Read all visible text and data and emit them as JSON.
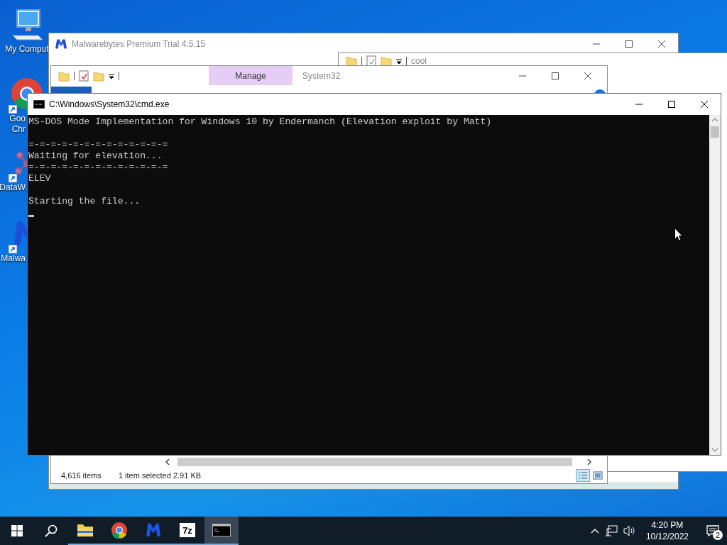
{
  "desktop_icons": [
    {
      "kind": "computer",
      "label_lines": [
        "My Comput"
      ],
      "shortcut": false
    },
    {
      "kind": "chrome",
      "label_lines": [
        "Goo",
        "Chr"
      ],
      "shortcut": true
    },
    {
      "kind": "data",
      "label_lines": [
        "DataW"
      ],
      "shortcut": true
    },
    {
      "kind": "malwarebytes",
      "label_lines": [
        "Malwa"
      ],
      "shortcut": true
    }
  ],
  "malwarebytes_window": {
    "title": "Malwarebytes Premium Trial  4.5.15"
  },
  "cool_window": {
    "title": "cool"
  },
  "system32_window": {
    "title": "System32",
    "context_tab": "Manage",
    "status_items": "4,616 items",
    "status_selected": "1 item selected  2.91 KB"
  },
  "cmd_window": {
    "title": "C:\\Windows\\System32\\cmd.exe",
    "cursor": true,
    "lines": [
      {
        "kind": "text",
        "text": "MS-DOS Mode Implementation for Windows 10 by Endermanch (Elevation exploit by Matt)"
      },
      {
        "kind": "blank"
      },
      {
        "kind": "text",
        "text": "=-=-=-=-=-=-=-=-=-=-=-=-="
      },
      {
        "kind": "text",
        "text": "Waiting for elevation..."
      },
      {
        "kind": "text",
        "text": "=-=-=-=-=-=-=-=-=-=-=-=-="
      },
      {
        "kind": "text",
        "text": "ELEV"
      },
      {
        "kind": "blank"
      },
      {
        "kind": "text",
        "text": "Starting the file..."
      }
    ]
  },
  "taskbar": {
    "apps": [
      {
        "kind": "explorer",
        "running": true,
        "selected": false
      },
      {
        "kind": "chrome",
        "running": true,
        "selected": false
      },
      {
        "kind": "malwarebytes",
        "running": true,
        "selected": false
      },
      {
        "kind": "sevenzip",
        "label": "7z",
        "running": true,
        "selected": false
      },
      {
        "kind": "terminal",
        "running": true,
        "selected": true
      }
    ],
    "time": "4:20 PM",
    "date": "10/12/2022",
    "notification_count": "2"
  }
}
